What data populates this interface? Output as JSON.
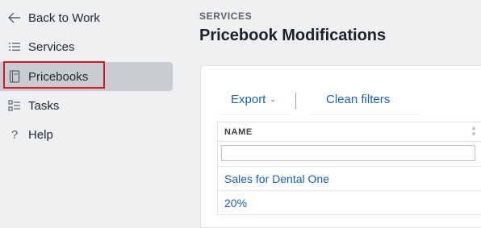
{
  "sidebar": {
    "items": [
      {
        "label": "Back to Work",
        "icon": "arrow-left-icon"
      },
      {
        "label": "Services",
        "icon": "list-icon"
      },
      {
        "label": "Pricebooks",
        "icon": "pricebook-icon",
        "active": true
      },
      {
        "label": "Tasks",
        "icon": "tasks-icon"
      },
      {
        "label": "Help",
        "icon": "question-icon"
      }
    ]
  },
  "header": {
    "eyebrow": "SERVICES",
    "title": "Pricebook Modifications"
  },
  "toolbar": {
    "export_label": "Export",
    "export_caret": "⌄",
    "clean_label": "Clean filters"
  },
  "table": {
    "columns": [
      {
        "label": "NAME"
      }
    ],
    "filter": {
      "value": "",
      "placeholder": ""
    },
    "rows": [
      {
        "name": "Sales for Dental One"
      },
      {
        "name": "20%"
      }
    ]
  },
  "colors": {
    "accent": "#1a5fb4",
    "highlight": "#d61a1f",
    "active_bg": "#c9cdd2"
  }
}
